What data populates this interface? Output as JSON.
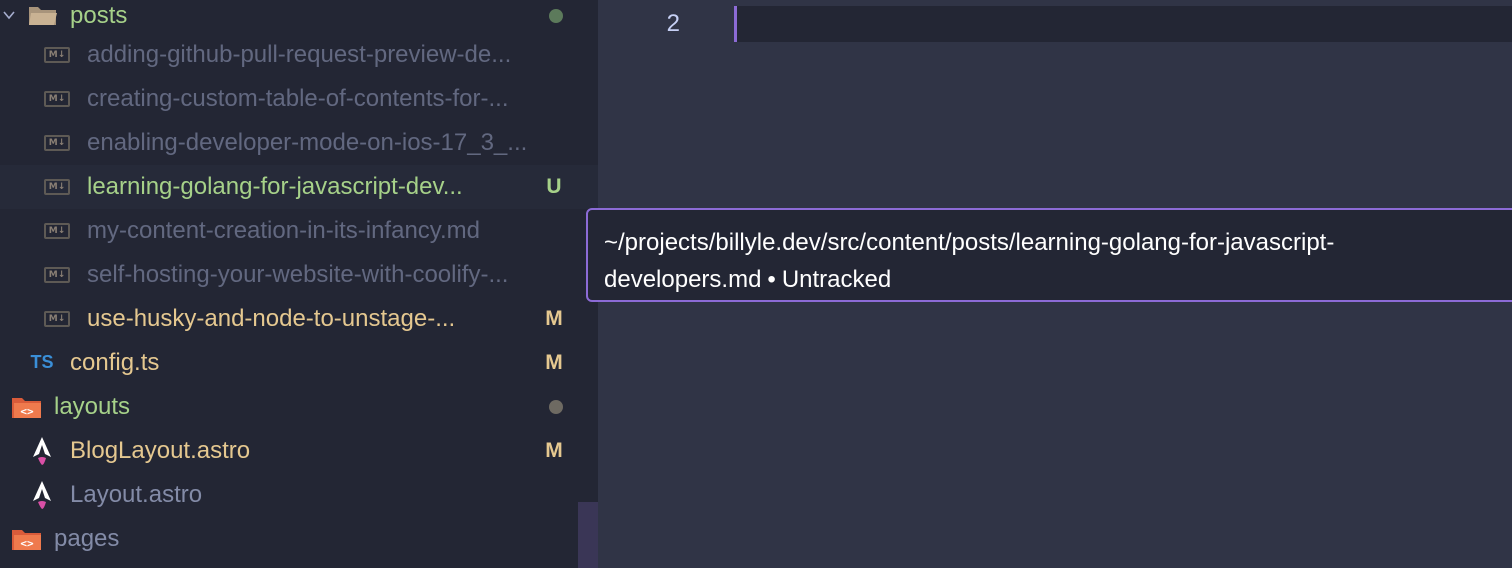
{
  "sidebar": {
    "folder_posts": {
      "label": "posts",
      "status_dot_color": "#5c7a5b"
    },
    "files": [
      {
        "label": "adding-github-pull-request-preview-de...",
        "icon": "markdown-icon",
        "status": "",
        "color": "#626880"
      },
      {
        "label": "creating-custom-table-of-contents-for-...",
        "icon": "markdown-icon",
        "status": "",
        "color": "#626880"
      },
      {
        "label": "enabling-developer-mode-on-ios-17_3_...",
        "icon": "markdown-icon",
        "status": "",
        "color": "#626880"
      },
      {
        "label": "learning-golang-for-javascript-dev...",
        "icon": "markdown-icon",
        "status": "U",
        "color": "#a6d189"
      },
      {
        "label": "my-content-creation-in-its-infancy.md",
        "icon": "markdown-icon",
        "status": "",
        "color": "#626880"
      },
      {
        "label": "self-hosting-your-website-with-coolify-...",
        "icon": "markdown-icon",
        "status": "",
        "color": "#626880"
      },
      {
        "label": "use-husky-and-node-to-unstage-...",
        "icon": "markdown-icon",
        "status": "M",
        "color": "#e5c890"
      }
    ],
    "config": {
      "label": "config.ts",
      "icon_text": "TS",
      "status": "M"
    },
    "folder_layouts": {
      "label": "layouts",
      "status_dot_color": "#6e6a62"
    },
    "blog_layout": {
      "label": "BlogLayout.astro",
      "status": "M"
    },
    "layout": {
      "label": "Layout.astro",
      "status": ""
    },
    "folder_pages": {
      "label": "pages"
    }
  },
  "editor": {
    "line_number": "2"
  },
  "tooltip": {
    "path_line1": "~/projects/billyle.dev/src/content/posts/learning-golang-for-javascript-",
    "path_line2": "developers.md",
    "separator": "•",
    "state": "Untracked"
  },
  "colors": {
    "sidebar_bg": "#232634",
    "editor_bg": "#303446",
    "accent": "#8c6bd6",
    "untracked": "#a6d189",
    "modified": "#e5c890",
    "ignored": "#626880",
    "folder_text": "#a6d189"
  }
}
